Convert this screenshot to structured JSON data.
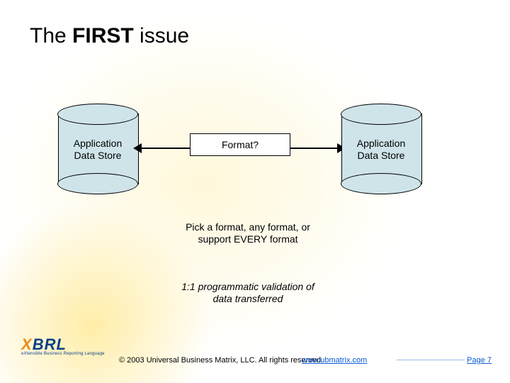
{
  "title": {
    "plain": "The ",
    "emph": "FIRST",
    "rest": " issue"
  },
  "diagram": {
    "left_label_l1": "Application",
    "left_label_l2": "Data Store",
    "right_label_l1": "Application",
    "right_label_l2": "Data Store",
    "format_box": "Format?"
  },
  "captions": {
    "pick": "Pick a format, any format, or support EVERY format",
    "validate": "1:1 programmatic validation of data transferred"
  },
  "footer": {
    "logo_letters": {
      "x": "X",
      "b": "B",
      "r": "R",
      "l": "L"
    },
    "logo_sub": "eXtensible Business Reporting Language",
    "copyright": "© 2003 Universal Business Matrix, LLC.  All rights reserved.",
    "link": "www.ubmatrix.com",
    "page": "Page 7"
  }
}
